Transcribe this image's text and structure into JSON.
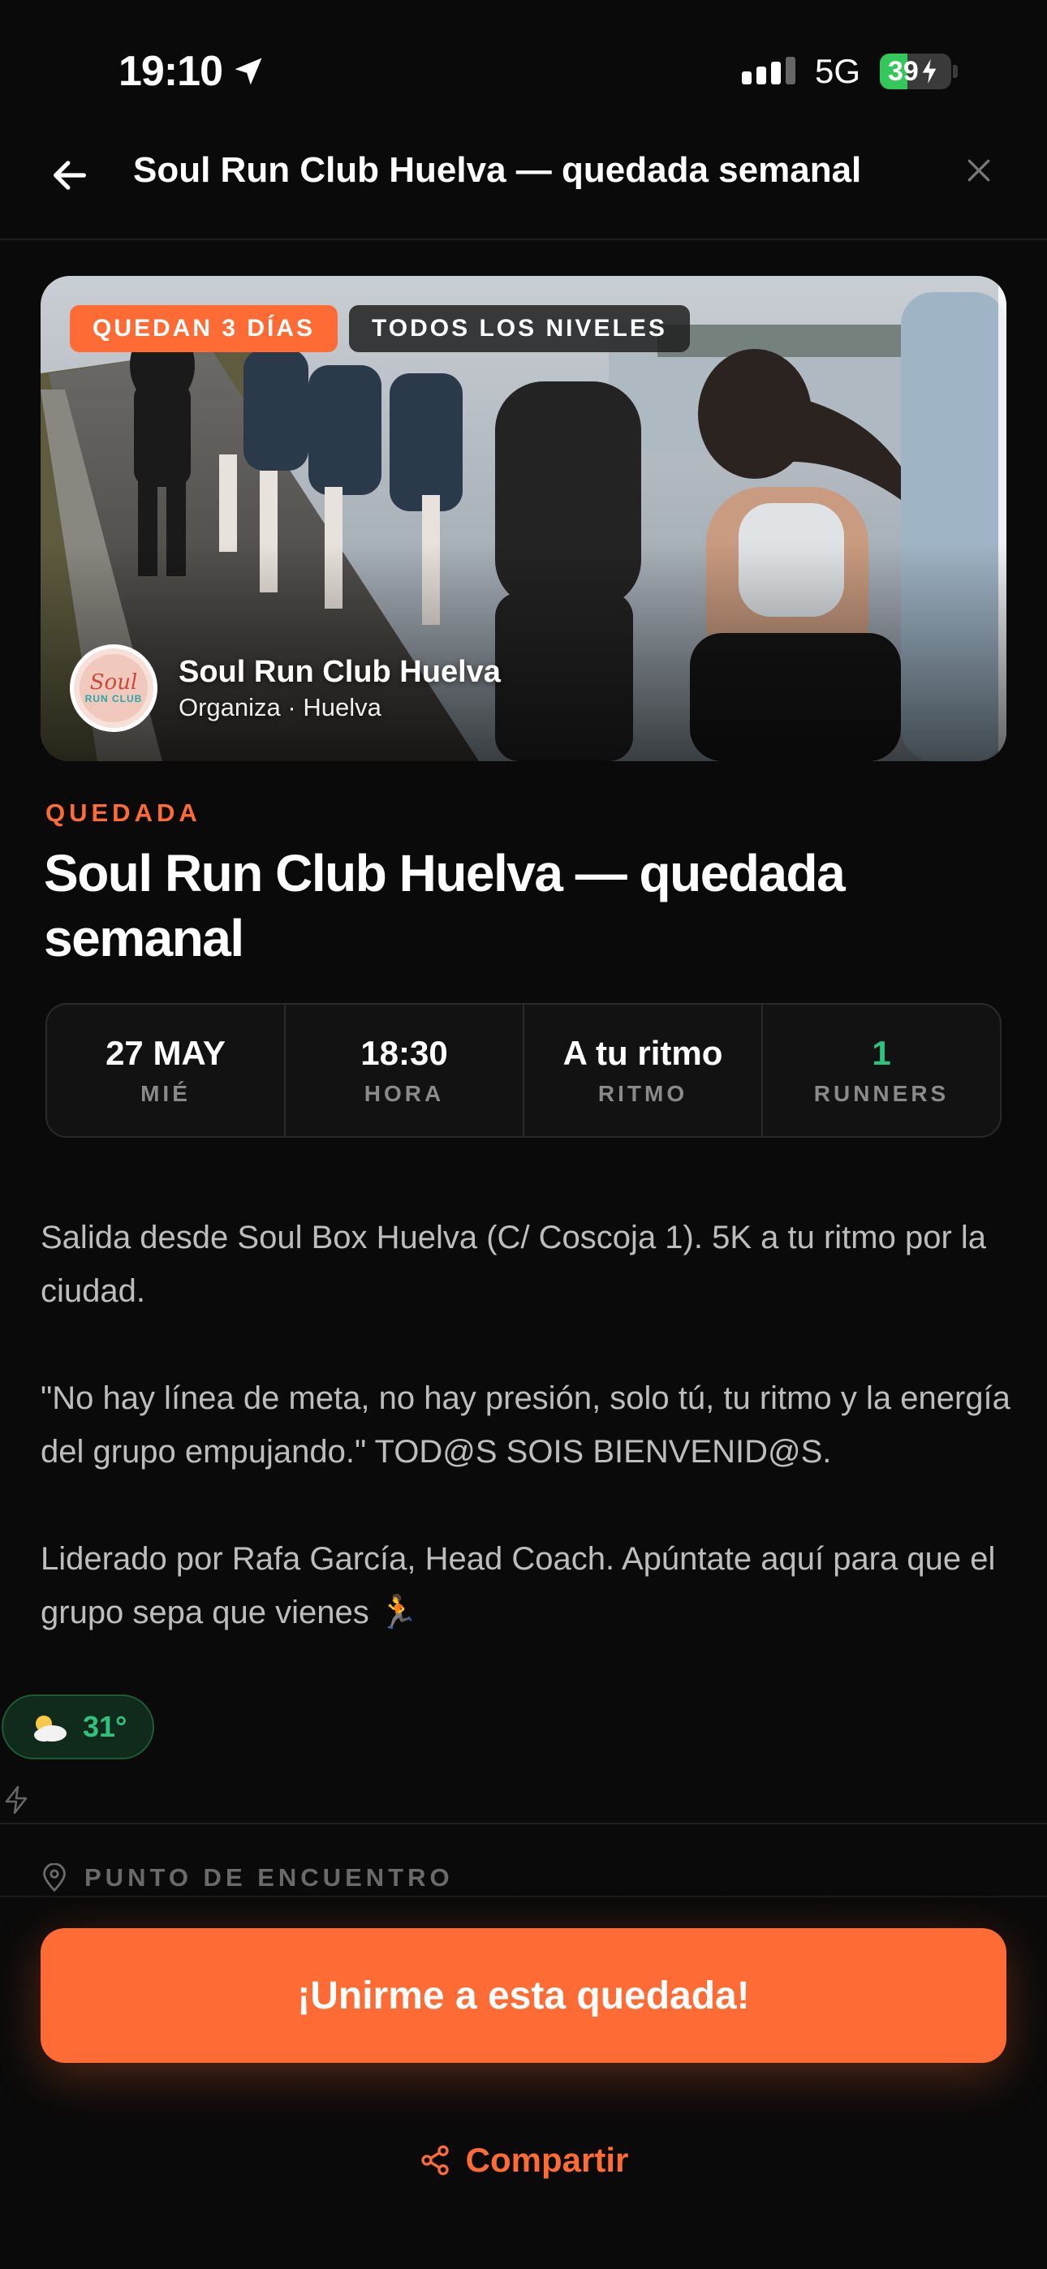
{
  "status_bar": {
    "time": "19:10",
    "network": "5G",
    "battery": "39",
    "battery_level": 0.39,
    "icons": [
      "location-arrow-icon",
      "signal-icon",
      "battery-charging-icon"
    ]
  },
  "header": {
    "title": "Soul Run Club Huelva — quedada semanal",
    "icons": [
      "back-arrow-icon",
      "close-icon"
    ]
  },
  "hero": {
    "badge_days": "QUEDAN 3 DÍAS",
    "badge_level": "TODOS LOS NIVELES",
    "organizer_name": "Soul Run Club Huelva",
    "organizer_sub": "Organiza · Huelva",
    "logo_text_top": "Soul",
    "logo_text_bottom": "RUN CLUB"
  },
  "event": {
    "kicker": "QUEDADA",
    "title": "Soul Run Club Huelva — quedada semanal"
  },
  "stats": [
    {
      "value": "27 MAY",
      "label": "MIÉ"
    },
    {
      "value": "18:30",
      "label": "HORA"
    },
    {
      "value": "A tu ritmo",
      "label": "RITMO"
    },
    {
      "value": "1",
      "label": "RUNNERS"
    }
  ],
  "description": {
    "p1": "Salida desde Soul Box Huelva (C/ Coscoja 1). 5K a tu ritmo por la ciudad.",
    "p2": "\"No hay línea de meta, no hay presión, solo tú, tu ritmo y la energía del grupo empujando.\" TOD@S SOIS BIENVENID@S.",
    "p3": "Liderado por Rafa García, Head Coach. Apúntate aquí para que el grupo sepa que vienes 🏃"
  },
  "weather": {
    "temp": "31°",
    "icon": "partly-cloudy-icon"
  },
  "meeting_point": {
    "label": "PUNTO DE ENCUENTRO",
    "icon": "map-pin-icon"
  },
  "actions": {
    "join": "¡Unirme a esta quedada!",
    "share": "Compartir",
    "share_icon": "share-icon"
  },
  "colors": {
    "accent": "#ff6b35",
    "background": "#0a0a0a",
    "success": "#2ec27e"
  }
}
